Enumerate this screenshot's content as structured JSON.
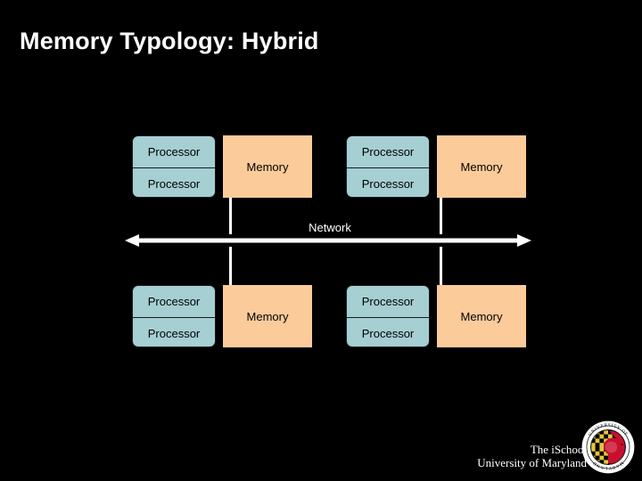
{
  "slide": {
    "title": "Memory Typology: Hybrid",
    "background_color": "#000000",
    "title_color": "#ffffff"
  },
  "diagram": {
    "type": "hybrid-memory-architecture",
    "processor_color": "#a5cfd3",
    "memory_color": "#fccb9a",
    "line_color": "#ffffff",
    "network": {
      "label": "Network",
      "arrow": "double-headed-horizontal"
    },
    "nodes": [
      {
        "id": "node-top-left",
        "processors": [
          "Processor",
          "Processor"
        ],
        "memory": "Memory"
      },
      {
        "id": "node-top-right",
        "processors": [
          "Processor",
          "Processor"
        ],
        "memory": "Memory"
      },
      {
        "id": "node-bottom-left",
        "processors": [
          "Processor",
          "Processor"
        ],
        "memory": "Memory"
      },
      {
        "id": "node-bottom-right",
        "processors": [
          "Processor",
          "Processor"
        ],
        "memory": "Memory"
      }
    ]
  },
  "footer": {
    "line1": "The iSchool",
    "line2": "University of Maryland",
    "seal": {
      "outer_text_top": "UNIVERSITY OF",
      "outer_text_bottom": "MARYLAND",
      "colors": {
        "ring": "#ffffff",
        "gold": "#e8c53a",
        "red": "#c8102e",
        "black": "#000000"
      }
    }
  }
}
